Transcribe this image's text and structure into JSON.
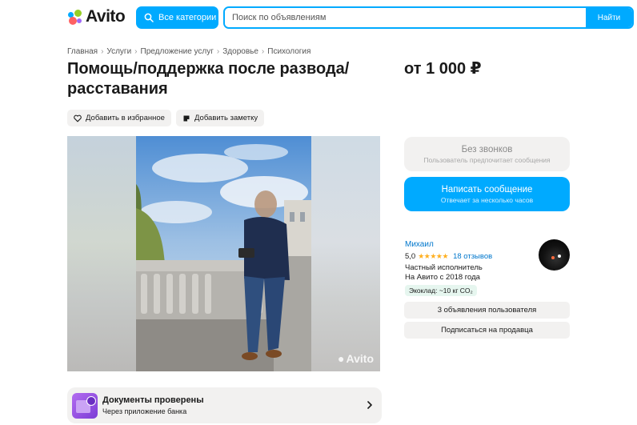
{
  "header": {
    "logo_text": "Avito",
    "categories_button": "Все категории",
    "search_placeholder": "Поиск по объявлениям",
    "search_button": "Найти"
  },
  "breadcrumb": [
    "Главная",
    "Услуги",
    "Предложение услуг",
    "Здоровье",
    "Психология"
  ],
  "listing": {
    "title": "Помощь/поддержка после развода/расставания",
    "price": "от 1 000 ₽",
    "favorite_label": "Добавить в избранное",
    "note_label": "Добавить заметку",
    "photo_watermark": "Avito"
  },
  "contact": {
    "no_calls_title": "Без звонков",
    "no_calls_sub": "Пользователь предпочитает сообщения",
    "message_title": "Написать сообщение",
    "message_sub": "Отвечает за несколько часов"
  },
  "seller": {
    "name": "Михаил",
    "rating": "5,0",
    "stars": "★★★★★",
    "reviews": "18 отзывов",
    "type": "Частный исполнитель",
    "since": "На Авито с 2018 года",
    "eco": "Экоклад: ~10 кг CO₂",
    "listings_button": "3 объявления пользователя",
    "subscribe_button": "Подписаться на продавца"
  },
  "documents": {
    "title": "Документы проверены",
    "subtitle": "Через приложение банка"
  },
  "colors": {
    "accent": "#00aaff",
    "link": "#0077cc",
    "soft_bg": "#f2f1f0",
    "star": "#ffb021"
  }
}
